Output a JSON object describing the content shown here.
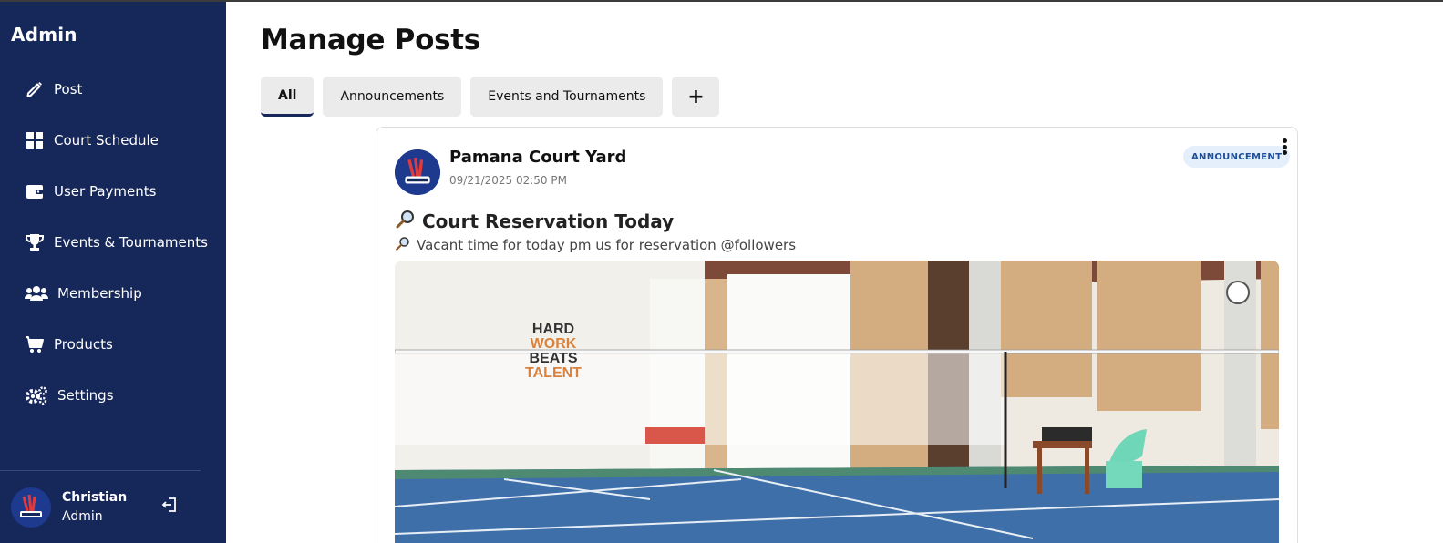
{
  "sidebar": {
    "title": "Admin",
    "items": [
      {
        "label": "Post",
        "icon": "pencil-icon"
      },
      {
        "label": "Court Schedule",
        "icon": "grid-icon"
      },
      {
        "label": "User Payments",
        "icon": "wallet-icon"
      },
      {
        "label": "Events & Tournaments",
        "icon": "trophy-icon"
      },
      {
        "label": "Membership",
        "icon": "users-icon"
      },
      {
        "label": "Products",
        "icon": "cart-icon"
      },
      {
        "label": "Settings",
        "icon": "gears-icon"
      }
    ],
    "user": {
      "name": "Christian",
      "role": "Admin"
    }
  },
  "main": {
    "title": "Manage Posts",
    "tabs": [
      {
        "label": "All",
        "active": true
      },
      {
        "label": "Announcements",
        "active": false
      },
      {
        "label": "Events and Tournaments",
        "active": false
      },
      {
        "label": "+",
        "active": false
      }
    ],
    "post": {
      "author": "Pamana Court Yard",
      "timestamp": "09/21/2025 02:50 PM",
      "badge": "ANNOUNCEMENT",
      "title": "Court Reservation Today",
      "body": "Vacant time for today pm us for reservation @followers",
      "image_text": {
        "line1": "HARD",
        "line2": "WORK",
        "line3": "BEATS",
        "line4": "TALENT"
      }
    }
  },
  "colors": {
    "sidebar_bg": "#16275a",
    "badge_bg": "#e4effb",
    "badge_text": "#1f4f9c",
    "court_blue": "#3f6fa8"
  }
}
